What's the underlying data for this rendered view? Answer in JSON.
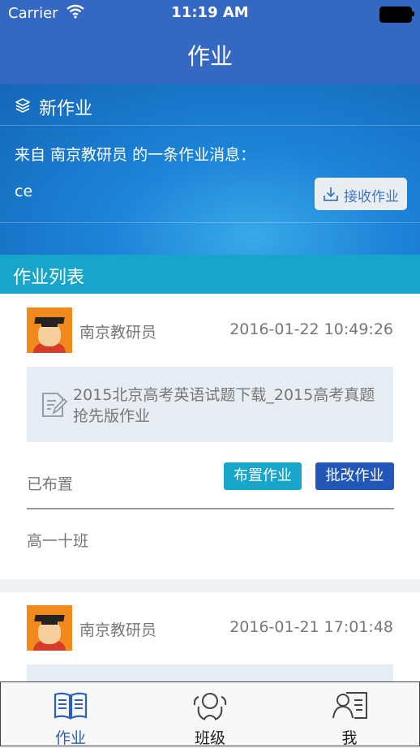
{
  "status_bar": {
    "carrier": "Carrier",
    "time": "11:19 AM"
  },
  "nav": {
    "title": "作业"
  },
  "new_homework": {
    "header": "新作业",
    "message": "来自 南京教研员 的一条作业消息：",
    "content": "ce",
    "receive_button": "接收作业"
  },
  "list": {
    "header": "作业列表",
    "items": [
      {
        "author": "南京教研员",
        "date": "2016-01-22 10:49:26",
        "title": "2015北京高考英语试题下载_2015高考真题抢先版作业",
        "status": "已布置",
        "assign_button": "布置作业",
        "grade_button": "批改作业",
        "class_name": "高一十班"
      },
      {
        "author": "南京教研员",
        "date": "2016-01-21 17:01:48"
      }
    ]
  },
  "tabs": [
    {
      "label": "作业",
      "icon": "book-icon",
      "active": true
    },
    {
      "label": "班级",
      "icon": "class-group-icon",
      "active": false
    },
    {
      "label": "我",
      "icon": "profile-card-icon",
      "active": false
    }
  ],
  "colors": {
    "nav_blue": "#3568c3",
    "teal": "#17a6c9",
    "dark_blue": "#2257b8",
    "active_tab": "#2b5fb8"
  }
}
